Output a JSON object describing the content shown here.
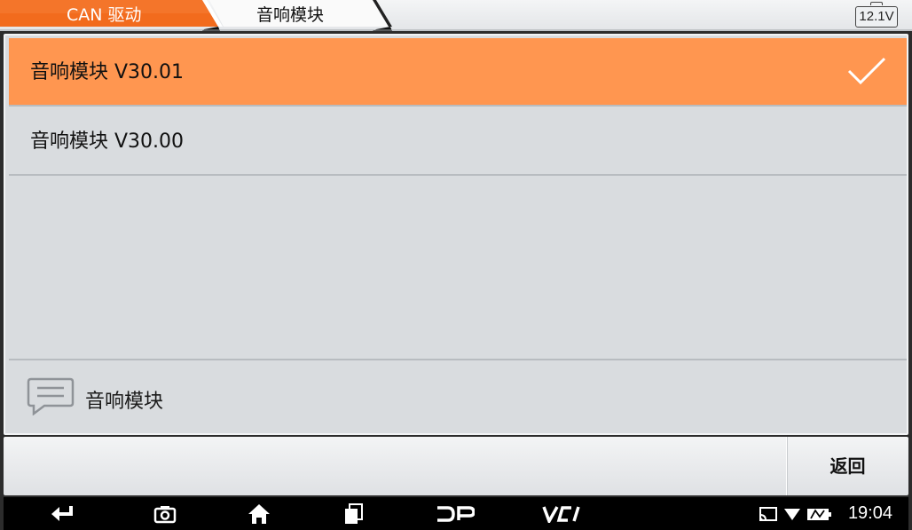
{
  "breadcrumb": {
    "items": [
      {
        "label": "CAN 驱动",
        "active": true
      },
      {
        "label": "音响模块",
        "active": false
      }
    ]
  },
  "battery": {
    "voltage": "12.1V"
  },
  "list": {
    "items": [
      {
        "label": "音响模块  V30.01",
        "selected": true
      },
      {
        "label": "音响模块  V30.00",
        "selected": false
      }
    ]
  },
  "message": {
    "text": "音响模块",
    "icon": "chat-bubble-icon"
  },
  "toolbar": {
    "back_label": "返回"
  },
  "navbar": {
    "icons": [
      "back-arrow-icon",
      "camera-icon",
      "home-icon",
      "recent-apps-icon",
      "dp-icon",
      "vci-icon"
    ],
    "status_icons": [
      "cast-icon",
      "wifi-icon",
      "battery-status-icon"
    ],
    "time": "19:04"
  },
  "colors": {
    "accent_orange": "#ff9650",
    "tab_orange": "#f26b1d",
    "panel_gray": "#d9dcdf"
  }
}
